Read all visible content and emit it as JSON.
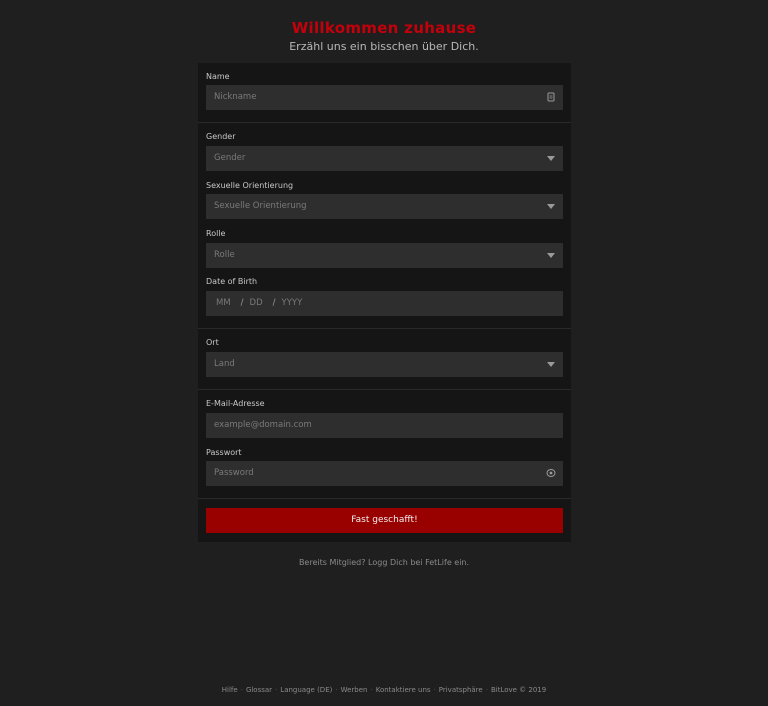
{
  "header": {
    "title": "Willkommen zuhause",
    "subtitle": "Erzähl uns ein bisschen über Dich."
  },
  "form": {
    "name": {
      "label": "Name",
      "placeholder": "Nickname"
    },
    "gender": {
      "label": "Gender",
      "placeholder": "Gender"
    },
    "orientation": {
      "label": "Sexuelle Orientierung",
      "placeholder": "Sexuelle Orientierung"
    },
    "role": {
      "label": "Rolle",
      "placeholder": "Rolle"
    },
    "dob": {
      "label": "Date of Birth",
      "mm": "MM",
      "dd": "DD",
      "yyyy": "YYYY",
      "separator": "/"
    },
    "location": {
      "label": "Ort",
      "placeholder": "Land"
    },
    "email": {
      "label": "E-Mail-Adresse",
      "placeholder": "example@domain.com"
    },
    "password": {
      "label": "Passwort",
      "placeholder": "Password"
    },
    "submit_label": "Fast geschafft!"
  },
  "login_link": "Bereits Mitglied? Logg Dich bei FetLife ein.",
  "footer": {
    "links": [
      "Hilfe",
      "Glossar",
      "Language (DE)",
      "Werben",
      "Kontaktiere uns",
      "Privatsphäre",
      "BitLove © 2019"
    ],
    "separator": "·"
  },
  "colors": {
    "accent": "#c4000b",
    "button": "#990000",
    "background": "#1f1f1f",
    "panel": "#151515",
    "field": "#2e2e2e"
  },
  "icons": {
    "name_field": "id-card-icon",
    "password_field": "eye-icon",
    "select": "caret-down-icon"
  }
}
